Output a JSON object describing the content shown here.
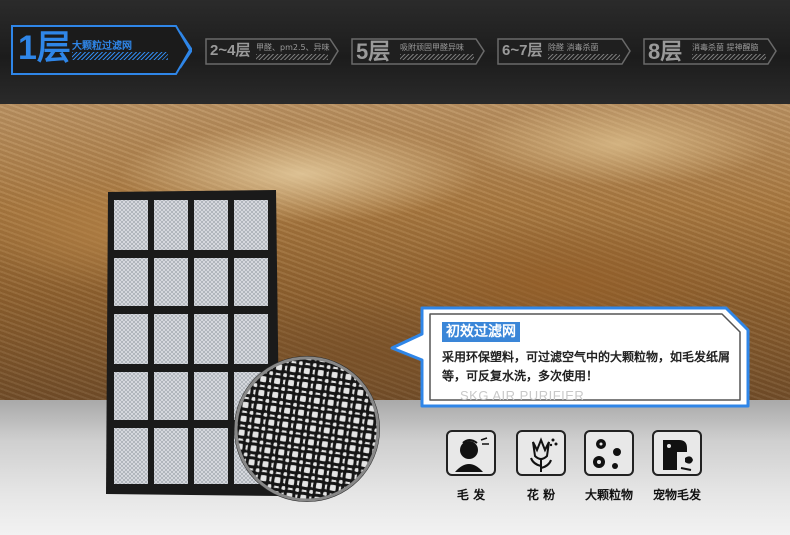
{
  "layers": [
    {
      "num": "1层",
      "desc": "大颗粒过滤网",
      "active": true
    },
    {
      "num": "2~4层",
      "desc": "甲醛、pm2.5、异味",
      "active": false
    },
    {
      "num": "5层",
      "desc": "吸附顽固甲醛异味",
      "active": false
    },
    {
      "num": "6~7层",
      "desc": "除醛 消毒杀菌",
      "active": false
    },
    {
      "num": "8层",
      "desc": "消毒杀菌 提神醒脑",
      "active": false
    }
  ],
  "callout": {
    "title": "初效过滤网",
    "body": "采用环保塑料，可过滤空气中的大颗粒物，如毛发纸屑等，可反复水洗，多次使用！",
    "watermark": "SKG AIR PURIFIER"
  },
  "features": [
    {
      "icon": "hair-person-icon",
      "label": "毛 发"
    },
    {
      "icon": "flower-pollen-icon",
      "label": "花 粉"
    },
    {
      "icon": "particles-icon",
      "label": "大颗粒物"
    },
    {
      "icon": "pet-dog-icon",
      "label": "宠物毛发"
    }
  ],
  "colors": {
    "accent": "#2f86e8",
    "inactive": "#9a9a9a",
    "topbar": "#232323"
  }
}
